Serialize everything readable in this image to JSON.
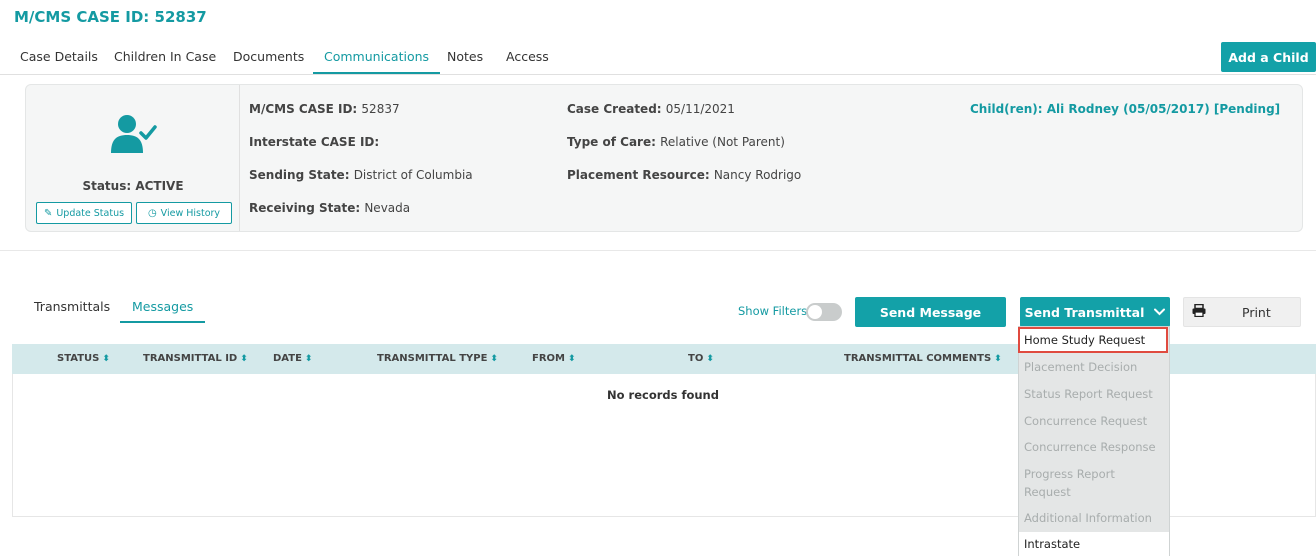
{
  "case_title": "M/CMS CASE ID: 52837",
  "tabs": [
    {
      "label": "Case Details"
    },
    {
      "label": "Children In Case"
    },
    {
      "label": "Documents"
    },
    {
      "label": "Communications"
    },
    {
      "label": "Notes"
    },
    {
      "label": "Access"
    }
  ],
  "active_tab": "Communications",
  "add_child_label": "Add a Child",
  "case_panel": {
    "status": "Status: ACTIVE",
    "update_status_label": "Update Status",
    "view_history_label": "View History",
    "fields": {
      "mcms_case_id": {
        "label": "M/CMS CASE ID:",
        "value": "52837"
      },
      "interstate_case_id": {
        "label": "Interstate CASE ID:",
        "value": ""
      },
      "sending_state": {
        "label": "Sending State:",
        "value": "District of Columbia"
      },
      "receiving_state": {
        "label": "Receiving State:",
        "value": "Nevada"
      },
      "case_created": {
        "label": "Case Created:",
        "value": "05/11/2021"
      },
      "type_of_care": {
        "label": "Type of Care:",
        "value": "Relative (Not Parent)"
      },
      "placement_resource": {
        "label": "Placement Resource:",
        "value": "Nancy Rodrigo"
      }
    },
    "children_link": "Child(ren): Ali Rodney (05/05/2017) [Pending]"
  },
  "subtabs": [
    {
      "label": "Transmittals"
    },
    {
      "label": "Messages"
    }
  ],
  "active_subtab": "Messages",
  "show_filters_label": "Show Filters",
  "send_message_label": "Send Message",
  "send_transmittal_label": "Send Transmittal",
  "print_label": "Print",
  "table": {
    "columns": [
      "STATUS",
      "TRANSMITTAL ID",
      "DATE",
      "TRANSMITTAL TYPE",
      "FROM",
      "TO",
      "TRANSMITTAL COMMENTS"
    ],
    "empty_text": "No records found"
  },
  "transmittal_menu": [
    {
      "label": "Home Study Request",
      "enabled": true,
      "highlighted": true
    },
    {
      "label": "Placement Decision",
      "enabled": false
    },
    {
      "label": "Status Report Request",
      "enabled": false
    },
    {
      "label": "Concurrence Request",
      "enabled": false
    },
    {
      "label": "Concurrence Response",
      "enabled": false
    },
    {
      "label": "Progress Report Request",
      "enabled": false
    },
    {
      "label": "Additional Information",
      "enabled": false
    },
    {
      "label": "Intrastate",
      "enabled": true
    }
  ],
  "colors": {
    "accent": "#13a1a8",
    "highlight_border": "#e04a3f",
    "table_header": "#d4e9eb"
  }
}
